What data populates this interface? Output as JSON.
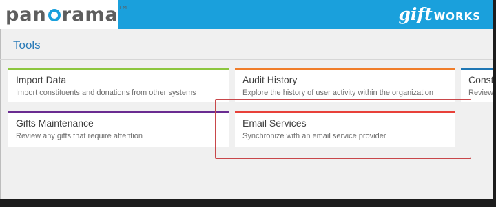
{
  "header": {
    "brand_left_prefix": "pan",
    "brand_left_suffix": "rama",
    "brand_left_tm": "TM",
    "brand_right_gift": "gift",
    "brand_right_works": "WORKS",
    "bar_color": "#1aa0dc"
  },
  "page": {
    "title": "Tools"
  },
  "tools": [
    {
      "title": "Import Data",
      "desc": "Import constituents and donations from other systems",
      "accent": "#8cc63f"
    },
    {
      "title": "Audit History",
      "desc": "Explore the history of user activity within the organization",
      "accent": "#f07d2a"
    },
    {
      "title": "Consti",
      "desc": "Review a",
      "accent": "#1f77b4"
    },
    {
      "title": "Gifts Maintenance",
      "desc": "Review any gifts that require attention",
      "accent": "#6a2c91"
    },
    {
      "title": "Email Services",
      "desc": "Synchronize with an email service provider",
      "accent": "#e8413a"
    }
  ],
  "highlight_color": "#c8474a"
}
